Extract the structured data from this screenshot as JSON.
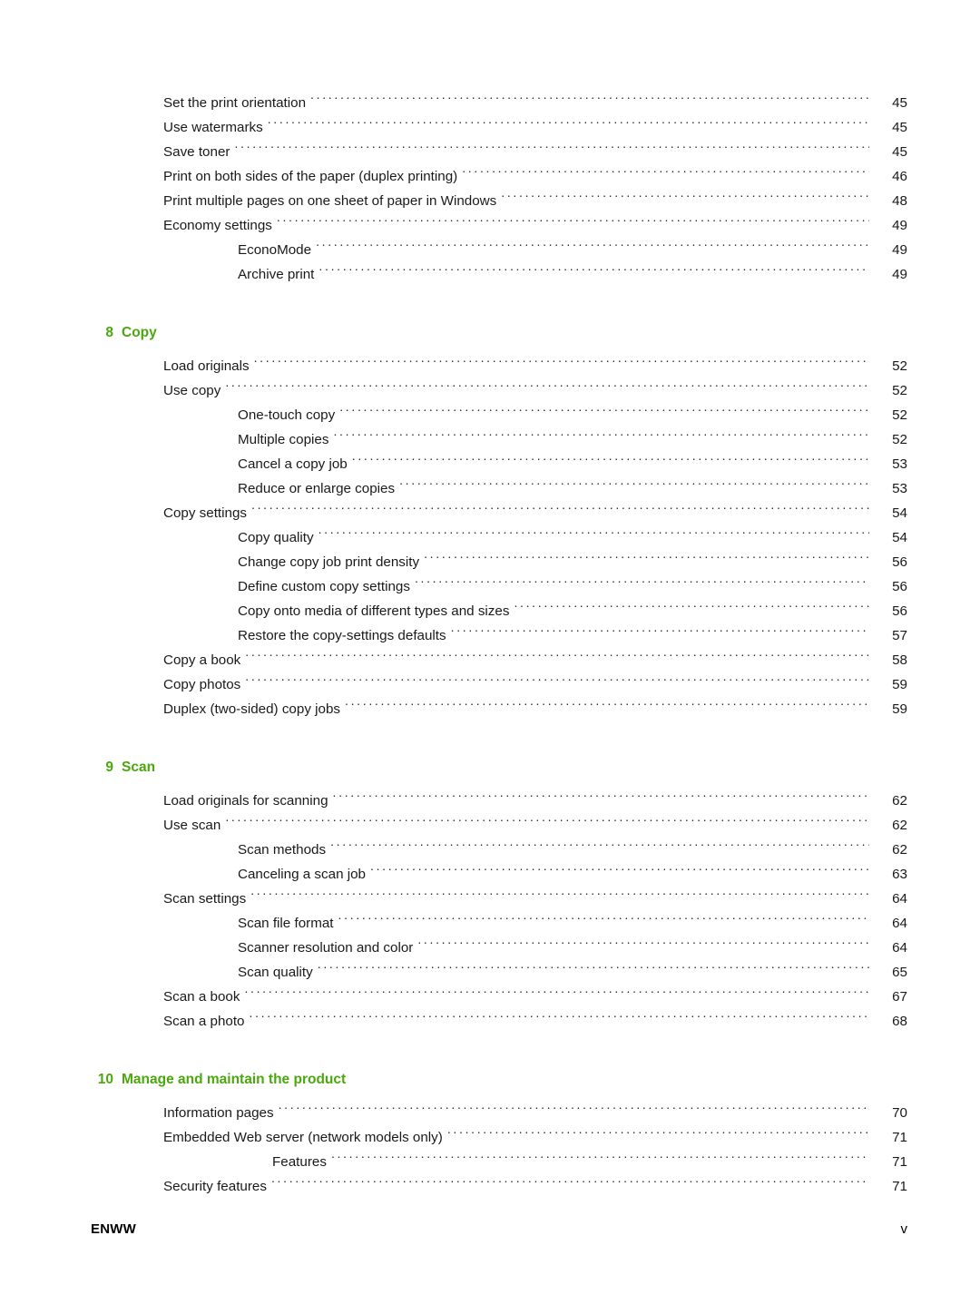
{
  "document": {
    "page_label": "v",
    "footer_left": "ENWW"
  },
  "toc": {
    "leading_entries": [
      {
        "label": "Set the print orientation",
        "page": "45",
        "level": 1
      },
      {
        "label": "Use watermarks",
        "page": "45",
        "level": 1
      },
      {
        "label": "Save toner",
        "page": "45",
        "level": 1
      },
      {
        "label": "Print on both sides of the paper (duplex printing)",
        "page": "46",
        "level": 1
      },
      {
        "label": "Print multiple pages on one sheet of paper in Windows",
        "page": "48",
        "level": 1
      },
      {
        "label": "Economy settings",
        "page": "49",
        "level": 1
      },
      {
        "label": "EconoMode",
        "page": "49",
        "level": 2
      },
      {
        "label": "Archive print",
        "page": "49",
        "level": 2
      }
    ],
    "chapters": [
      {
        "number": "8",
        "title": "Copy",
        "entries": [
          {
            "label": "Load originals",
            "page": "52",
            "level": 1
          },
          {
            "label": "Use copy",
            "page": "52",
            "level": 1
          },
          {
            "label": "One-touch copy",
            "page": "52",
            "level": 2
          },
          {
            "label": "Multiple copies",
            "page": "52",
            "level": 2
          },
          {
            "label": "Cancel a copy job",
            "page": "53",
            "level": 2
          },
          {
            "label": "Reduce or enlarge copies",
            "page": "53",
            "level": 2
          },
          {
            "label": "Copy settings",
            "page": "54",
            "level": 1
          },
          {
            "label": "Copy quality",
            "page": "54",
            "level": 2
          },
          {
            "label": "Change copy job print density",
            "page": "56",
            "level": 2
          },
          {
            "label": "Define custom copy settings",
            "page": "56",
            "level": 2
          },
          {
            "label": "Copy onto media of different types and sizes",
            "page": "56",
            "level": 2
          },
          {
            "label": "Restore the copy-settings defaults",
            "page": "57",
            "level": 2
          },
          {
            "label": "Copy a book",
            "page": "58",
            "level": 1
          },
          {
            "label": "Copy photos",
            "page": "59",
            "level": 1
          },
          {
            "label": "Duplex (two-sided) copy jobs",
            "page": "59",
            "level": 1
          }
        ]
      },
      {
        "number": "9",
        "title": "Scan",
        "entries": [
          {
            "label": "Load originals for scanning",
            "page": "62",
            "level": 1
          },
          {
            "label": "Use scan",
            "page": "62",
            "level": 1
          },
          {
            "label": "Scan methods",
            "page": "62",
            "level": 2
          },
          {
            "label": "Canceling a scan job",
            "page": "63",
            "level": 2
          },
          {
            "label": "Scan settings",
            "page": "64",
            "level": 1
          },
          {
            "label": "Scan file format",
            "page": "64",
            "level": 2
          },
          {
            "label": "Scanner resolution and color",
            "page": "64",
            "level": 2
          },
          {
            "label": "Scan quality",
            "page": "65",
            "level": 2
          },
          {
            "label": "Scan a book",
            "page": "67",
            "level": 1
          },
          {
            "label": "Scan a photo",
            "page": "68",
            "level": 1
          }
        ]
      },
      {
        "number": "10",
        "title": "Manage and maintain the product",
        "entries": [
          {
            "label": "Information pages",
            "page": "70",
            "level": 1
          },
          {
            "label": "Embedded Web server (network models only)",
            "page": "71",
            "level": 1
          },
          {
            "label": "Features",
            "page": "71",
            "level": 3
          },
          {
            "label": "Security features",
            "page": "71",
            "level": 1
          }
        ]
      }
    ]
  },
  "colors": {
    "heading_green": "#4aa80e",
    "body_text": "#1a1a1a",
    "page_background": "#ffffff"
  }
}
